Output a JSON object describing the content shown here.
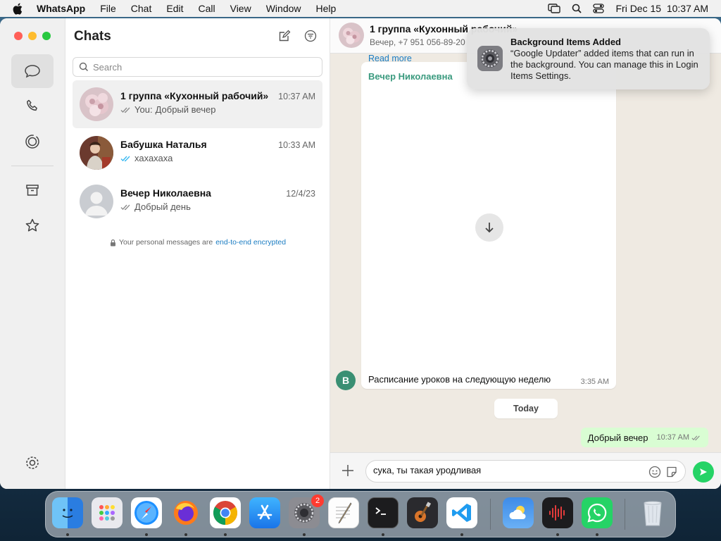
{
  "menubar": {
    "app": "WhatsApp",
    "items": [
      "File",
      "Chat",
      "Edit",
      "Call",
      "View",
      "Window",
      "Help"
    ],
    "clock": "Fri Dec 15  10:37 AM"
  },
  "sidebar": {
    "title": "Chats",
    "search_placeholder": "Search",
    "chats": [
      {
        "name": "1 группа «Кухонный рабочий»",
        "time": "10:37 AM",
        "prefix": "You:",
        "preview": "Добрый вечер",
        "ticks": "read-gray"
      },
      {
        "name": "Бабушка Наталья",
        "time": "10:33 AM",
        "prefix": "",
        "preview": "хахахаха",
        "ticks": "read-blue"
      },
      {
        "name": "Вечер Николаевна",
        "time": "12/4/23",
        "prefix": "",
        "preview": "Добрый день",
        "ticks": "read-gray"
      }
    ],
    "encryption_note": "Your personal messages are",
    "encryption_link": "end-to-end encrypted"
  },
  "conversation": {
    "title": "1 группа «Кухонный рабочий»",
    "subtitle": "Вечер, +7 951 056-89-20",
    "read_more": "Read more",
    "sender": "Вечер Николаевна",
    "sender_initial": "B",
    "message_text": "Расписание уроков на следующую неделю",
    "message_time": "3:35 AM",
    "date_separator": "Today",
    "outgoing_text": "Добрый вечер",
    "outgoing_time": "10:37 AM",
    "composer_value": "сука, ты такая уродливая"
  },
  "notification": {
    "title": "Background Items Added",
    "body": "“Google Updater” added items that can run in the background. You can manage this in Login Items Settings."
  },
  "dock": {
    "settings_badge": "2",
    "apps": [
      "Finder",
      "Launchpad",
      "Safari",
      "Firefox",
      "Chrome",
      "App Store",
      "System Settings",
      "TextEdit",
      "Terminal",
      "GarageBand",
      "VS Code",
      "Weather",
      "Voice Memos",
      "WhatsApp",
      "Trash"
    ]
  },
  "colors": {
    "accent_green": "#25d366",
    "sender_green": "#3a9a7e",
    "link_blue": "#1a7cc2",
    "outgoing_bubble": "#d9fdd3",
    "chat_bg": "#efeae2"
  }
}
